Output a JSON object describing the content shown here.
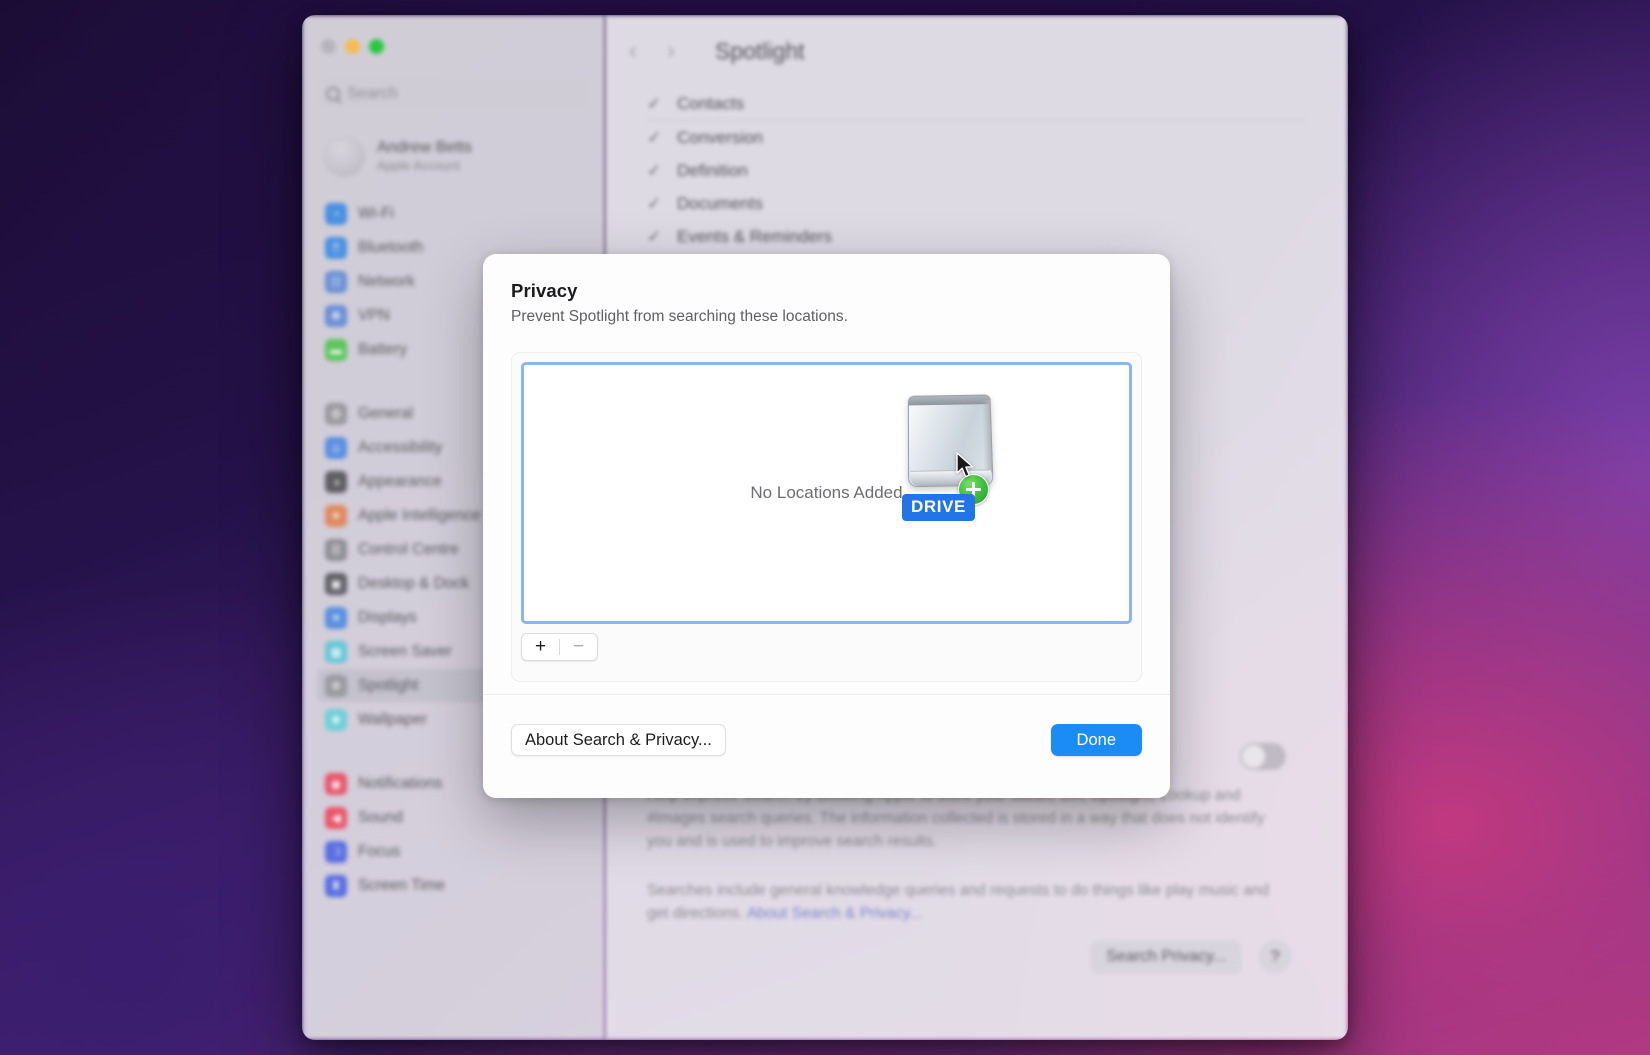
{
  "window": {
    "traffic_lights": [
      "close",
      "minimize",
      "zoom"
    ],
    "nav": {
      "back_icon": "‹",
      "forward_icon": "›",
      "title": "Spotlight"
    }
  },
  "sidebar": {
    "search": {
      "placeholder": "Search",
      "icon": "search-icon"
    },
    "account": {
      "name": "Andrew Betts",
      "subtitle": "Apple Account"
    },
    "groups": [
      {
        "items": [
          {
            "label": "Wi-Fi",
            "icon": "wifi-icon",
            "color": "#4a90e2",
            "glyph": "◔",
            "active": false
          },
          {
            "label": "Bluetooth",
            "icon": "bluetooth-icon",
            "color": "#4a90e2",
            "glyph": "ᛗ",
            "active": false
          },
          {
            "label": "Network",
            "icon": "network-icon",
            "color": "#6b8fd4",
            "glyph": "☷",
            "active": false
          },
          {
            "label": "VPN",
            "icon": "vpn-icon",
            "color": "#6b8fd4",
            "glyph": "☸",
            "active": false
          },
          {
            "label": "Battery",
            "icon": "battery-icon",
            "color": "#5cc55c",
            "glyph": "▬",
            "active": false
          }
        ]
      },
      {
        "items": [
          {
            "label": "General",
            "icon": "gear-icon",
            "color": "#9a9aa0",
            "glyph": "⚙",
            "active": false
          },
          {
            "label": "Accessibility",
            "icon": "accessibility-icon",
            "color": "#5b8fe0",
            "glyph": "☺",
            "active": false
          },
          {
            "label": "Appearance",
            "icon": "appearance-icon",
            "color": "#5e5e64",
            "glyph": "◑",
            "active": false
          },
          {
            "label": "Apple Intelligence",
            "icon": "sparkle-icon",
            "color": "#e08a63",
            "glyph": "✦",
            "active": false
          },
          {
            "label": "Control Centre",
            "icon": "control-centre-icon",
            "color": "#8e8e94",
            "glyph": "☰",
            "active": false
          },
          {
            "label": "Desktop & Dock",
            "icon": "desktop-dock-icon",
            "color": "#5e5e64",
            "glyph": "▣",
            "active": false
          },
          {
            "label": "Displays",
            "icon": "displays-icon",
            "color": "#5b8fe0",
            "glyph": "☀",
            "active": false
          },
          {
            "label": "Screen Saver",
            "icon": "screen-saver-icon",
            "color": "#63c6d8",
            "glyph": "▦",
            "active": false
          },
          {
            "label": "Spotlight",
            "icon": "spotlight-icon",
            "color": "#9a9aa0",
            "glyph": "✲",
            "active": true
          },
          {
            "label": "Wallpaper",
            "icon": "wallpaper-icon",
            "color": "#6fd0d8",
            "glyph": "❖",
            "active": false
          }
        ]
      },
      {
        "items": [
          {
            "label": "Notifications",
            "icon": "notifications-icon",
            "color": "#e9566a",
            "glyph": "◉",
            "active": false
          },
          {
            "label": "Sound",
            "icon": "sound-icon",
            "color": "#e9566a",
            "glyph": "◀",
            "active": false
          },
          {
            "label": "Focus",
            "icon": "focus-icon",
            "color": "#5b6fe0",
            "glyph": "☽",
            "active": false
          },
          {
            "label": "Screen Time",
            "icon": "screen-time-icon",
            "color": "#5b6fe0",
            "glyph": "⧗",
            "active": false
          }
        ]
      }
    ]
  },
  "detail": {
    "search_results_rows": [
      {
        "label": "Contacts",
        "checked": true,
        "tick": "✓"
      },
      {
        "label": "Conversion",
        "checked": true,
        "tick": "✓"
      },
      {
        "label": "Definition",
        "checked": true,
        "tick": "✓"
      },
      {
        "label": "Documents",
        "checked": true,
        "tick": "✓"
      },
      {
        "label": "Events & Reminders",
        "checked": true,
        "tick": "✓"
      }
    ],
    "help_improve_paragraph": "Help improve Search by allowing Apple to store your Safari, Siri, Spotlight, Lookup and #images search queries. The information collected is stored in a way that does not identify you and is used to improve search results.",
    "searches_paragraph_prefix": "Searches include general knowledge queries and requests to do things like play music and get directions. ",
    "searches_paragraph_link": "About Search & Privacy...",
    "help_improve_toggle": "off",
    "search_privacy_button": "Search Privacy...",
    "help_button": "?"
  },
  "privacy_sheet": {
    "title": "Privacy",
    "subtitle": "Prevent Spotlight from searching these locations.",
    "empty_message": "No Locations Added",
    "add_button": "+",
    "remove_button": "−",
    "about_button": "About Search & Privacy...",
    "done_button": "Done",
    "accent_color": "#1b8cf5",
    "focus_ring_color": "#8cb4ee"
  },
  "drag": {
    "item_name": "DRIVE",
    "badge": "add-badge-plus",
    "badge_color": "#3cba3a",
    "label_color": "#2374e6",
    "cursor": "arrow-cursor"
  }
}
